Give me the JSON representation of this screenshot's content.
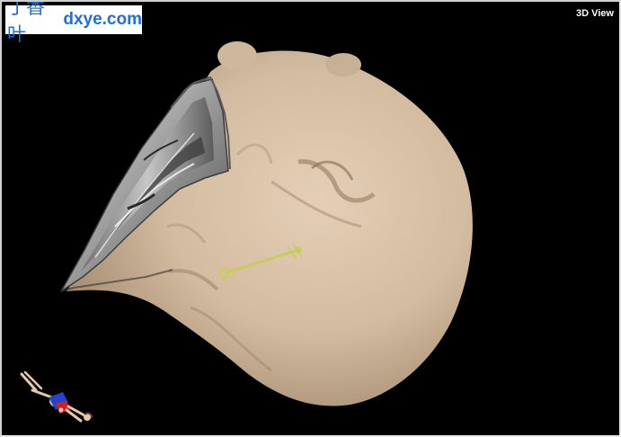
{
  "watermark": {
    "cjk": "丁香叶",
    "latin": "dxye.com"
  },
  "view": {
    "label": "3D View"
  },
  "icons": {
    "head_model": "3d-head-surface-render",
    "slice_planes": "mri-slice-cutaway",
    "trajectory": "needle-trajectory-line",
    "orientation": "orientation-figure-icon"
  },
  "colors": {
    "background": "#000000",
    "skin": "#d6bfa4",
    "trajectory": "#c8cc5a",
    "label": "#ffffff",
    "watermark_text": "#1f6fd6"
  }
}
